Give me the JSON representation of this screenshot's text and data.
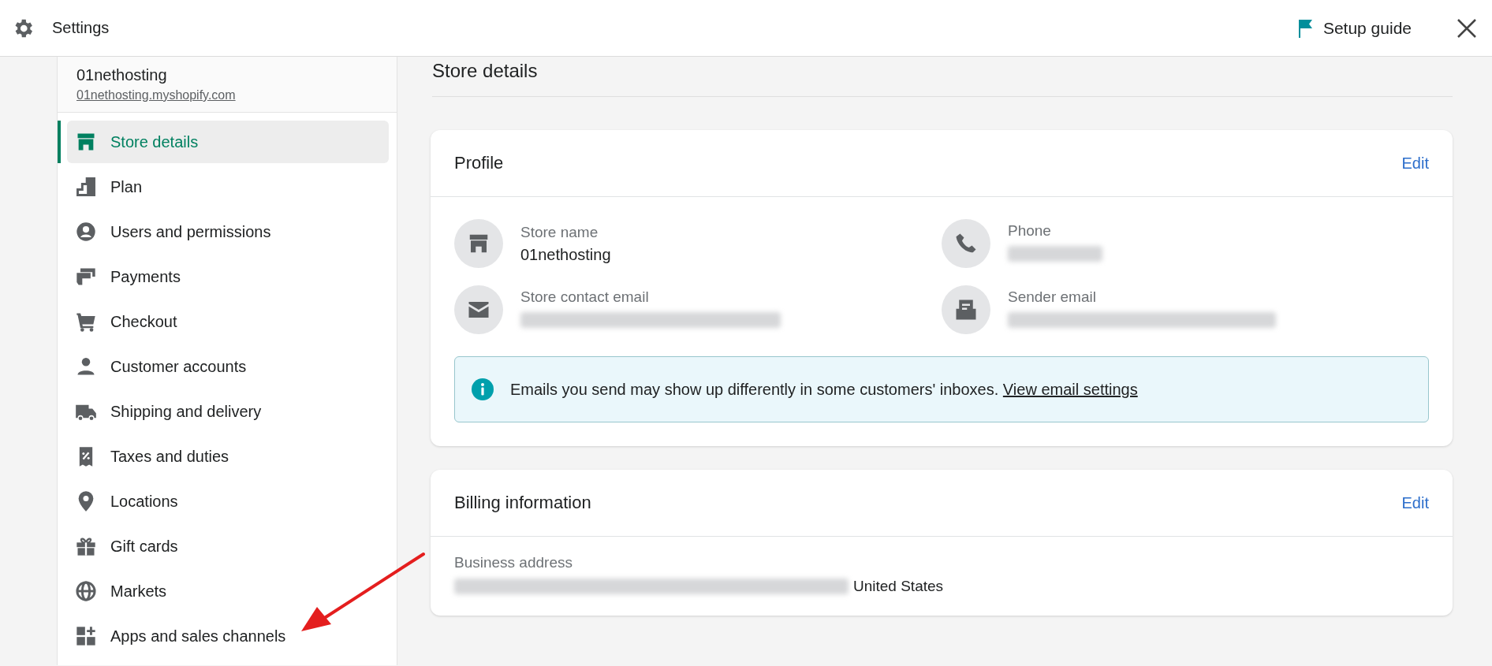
{
  "topbar": {
    "title": "Settings",
    "setup_guide": "Setup guide"
  },
  "store": {
    "name": "01nethosting",
    "url": "01nethosting.myshopify.com"
  },
  "nav": [
    {
      "label": "Store details",
      "selected": true
    },
    {
      "label": "Plan",
      "selected": false
    },
    {
      "label": "Users and permissions",
      "selected": false
    },
    {
      "label": "Payments",
      "selected": false
    },
    {
      "label": "Checkout",
      "selected": false
    },
    {
      "label": "Customer accounts",
      "selected": false
    },
    {
      "label": "Shipping and delivery",
      "selected": false
    },
    {
      "label": "Taxes and duties",
      "selected": false
    },
    {
      "label": "Locations",
      "selected": false
    },
    {
      "label": "Gift cards",
      "selected": false
    },
    {
      "label": "Markets",
      "selected": false
    },
    {
      "label": "Apps and sales channels",
      "selected": false
    }
  ],
  "page_title": "Store details",
  "profile": {
    "title": "Profile",
    "edit": "Edit",
    "fields": [
      {
        "label": "Store name",
        "kind": "text",
        "value": "01nethosting"
      },
      {
        "label": "Phone",
        "kind": "blurred"
      },
      {
        "label": "Store contact email",
        "kind": "blurred"
      },
      {
        "label": "Sender email",
        "kind": "blurred"
      }
    ],
    "notice": {
      "text": "Emails you send may show up differently in some customers' inboxes.",
      "link": "View email settings"
    }
  },
  "billing": {
    "title": "Billing information",
    "edit": "Edit",
    "fields": [
      {
        "label": "Business address",
        "kind": "partly_blurred",
        "value": "United States"
      }
    ]
  }
}
